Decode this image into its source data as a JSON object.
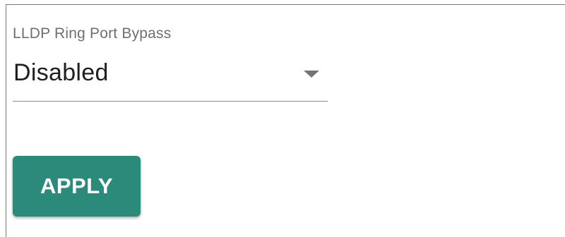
{
  "form": {
    "field": {
      "label": "LLDP Ring Port Bypass",
      "selected_value": "Disabled"
    },
    "apply_label": "APPLY"
  },
  "icons": {
    "dropdown": "dropdown-arrow-icon"
  },
  "colors": {
    "button_background": "#2c8a7a",
    "button_text": "#ffffff",
    "label_text": "#6f6f6f",
    "value_text": "#1f1f1f",
    "underline": "#8a8a8a"
  }
}
